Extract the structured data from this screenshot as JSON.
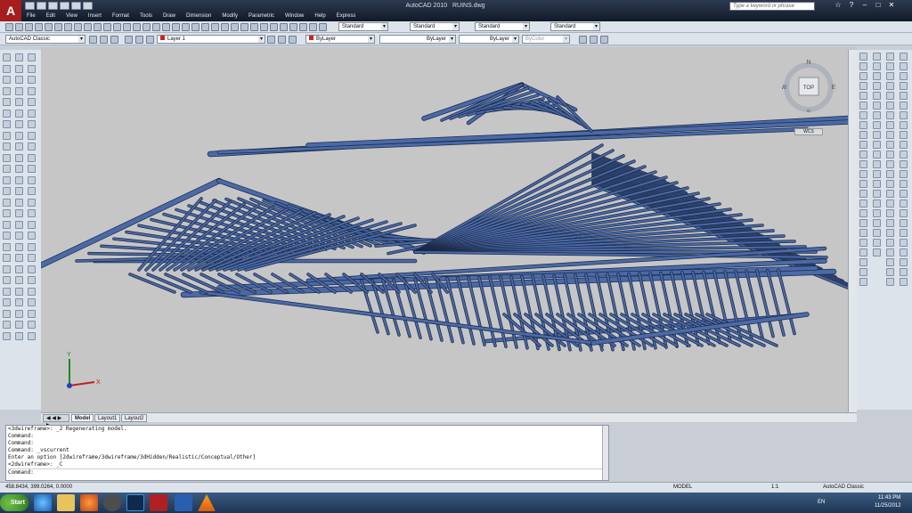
{
  "titlebar": {
    "app_title": "AutoCAD 2010",
    "file_name": "RUINS.dwg",
    "search_placeholder": "Type a keyword or phrase",
    "logo_letter": "A"
  },
  "menu": [
    "File",
    "Edit",
    "View",
    "Insert",
    "Format",
    "Tools",
    "Draw",
    "Dimension",
    "Modify",
    "Parametric",
    "Window",
    "Help",
    "Express"
  ],
  "styles": {
    "text_style": "Standard",
    "dim_style": "Standard",
    "table_style": "Standard",
    "multileader_style": "Standard"
  },
  "workspace": "AutoCAD Classic",
  "layer": "Layer 1",
  "color": "ByLayer",
  "linetype": "ByLayer",
  "lineweight": "ByLayer",
  "plotstyle": "ByColor",
  "navcube": {
    "face": "TOP",
    "n": "N",
    "s": "S",
    "e": "E",
    "w": "W",
    "wcs": "WCS"
  },
  "ucs": {
    "x": "X",
    "y": "Y"
  },
  "tabs": [
    "Model",
    "Layout1",
    "Layout2"
  ],
  "command_history": [
    "<3dwireframe>: _2 Regenerating model.",
    "Command:",
    "Command:",
    "Command: _vscurrent",
    "Enter an option [2dwireframe/3dwireframe/3dHidden/Realistic/Conceptual/Other]",
    "<2dwireframe>: _C"
  ],
  "command_prompt": "Command:",
  "status": {
    "coords": "458.8434, 399.0264, 0.0000",
    "model": "MODEL",
    "scale": "1:1",
    "workspace": "AutoCAD Classic"
  },
  "taskbar": {
    "start": "Start",
    "lang": "EN",
    "time": "11:43 PM",
    "date": "11/25/2012"
  },
  "colors": {
    "model": "#4a6aa8",
    "model_edge": "#1c2a48",
    "viewport": "#c6c6c6"
  }
}
